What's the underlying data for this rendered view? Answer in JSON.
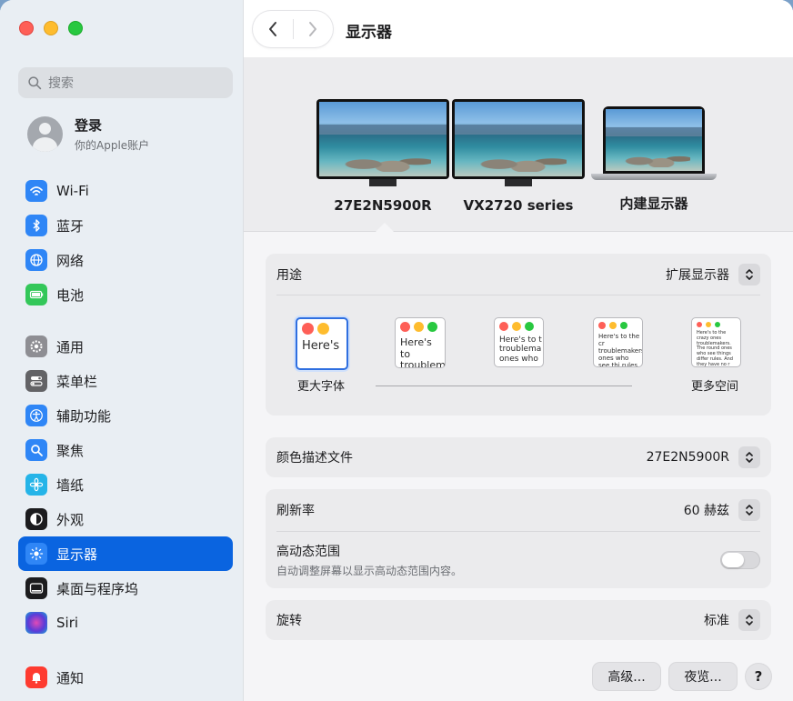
{
  "sidebar": {
    "search": {
      "placeholder": "搜索"
    },
    "account": {
      "title": "登录",
      "subtitle": "你的Apple账户"
    },
    "groups": [
      [
        {
          "label": "Wi-Fi",
          "icon": "wifi-icon",
          "color": "#2f86f6"
        },
        {
          "label": "蓝牙",
          "icon": "bluetooth-icon",
          "color": "#2f86f6"
        },
        {
          "label": "网络",
          "icon": "globe-icon",
          "color": "#2f86f6"
        },
        {
          "label": "电池",
          "icon": "battery-icon",
          "color": "#33c759"
        }
      ],
      [
        {
          "label": "通用",
          "icon": "gear-icon",
          "color": "#8e8e93"
        },
        {
          "label": "菜单栏",
          "icon": "menubar-icon",
          "color": "#636366"
        },
        {
          "label": "辅助功能",
          "icon": "accessibility-icon",
          "color": "#2f86f6"
        },
        {
          "label": "聚焦",
          "icon": "spotlight-icon",
          "color": "#2f86f6"
        },
        {
          "label": "墙纸",
          "icon": "wallpaper-icon",
          "color": "#25b4e8"
        },
        {
          "label": "外观",
          "icon": "appearance-icon",
          "color": "#1c1c1e"
        },
        {
          "label": "显示器",
          "icon": "display-icon",
          "color": "#2f86f6",
          "active": true
        },
        {
          "label": "桌面与程序坞",
          "icon": "dock-icon",
          "color": "#1c1c1e"
        },
        {
          "label": "Siri",
          "icon": "siri-icon",
          "color": "#6a3fd8"
        }
      ],
      [
        {
          "label": "通知",
          "icon": "notification-icon",
          "color": "#fe3b30"
        }
      ]
    ]
  },
  "header": {
    "title": "显示器"
  },
  "monitors": [
    {
      "label": "27E2N5900R",
      "type": "external"
    },
    {
      "label": "VX2720 series",
      "type": "external"
    },
    {
      "label": "内建显示器",
      "type": "laptop"
    }
  ],
  "usage": {
    "label": "用途",
    "value": "扩展显示器",
    "thumb_texts": [
      "Here's",
      "Here's to troublem",
      "Here's to t troublema ones who",
      "Here's to the cr troublemakers. ones who see thi rules. And they",
      "Here's to the crazy ones troublemakers. The round ones who see things differ rules. And they have no r can quote them, disagree them. About the only th Because they change thi"
    ],
    "left_caption": "更大字体",
    "right_caption": "更多空间",
    "selected_index": 0
  },
  "color_profile": {
    "label": "颜色描述文件",
    "value": "27E2N5900R"
  },
  "refresh": {
    "label": "刷新率",
    "value": "60 赫兹"
  },
  "hdr": {
    "label": "高动态范围",
    "description": "自动调整屏幕以显示高动态范围内容。",
    "enabled": false
  },
  "rotation": {
    "label": "旋转",
    "value": "标准"
  },
  "footer": {
    "advanced": "高级...",
    "night_shift": "夜览...",
    "help": "?"
  }
}
